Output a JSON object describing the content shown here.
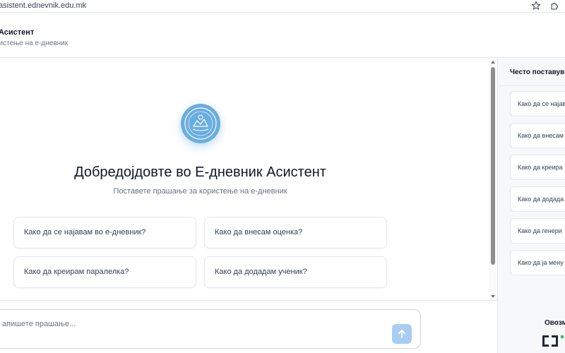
{
  "browser": {
    "url": "asistent.ednevnik.edu.mk",
    "icons": [
      "star-icon",
      "extensions-icon"
    ]
  },
  "header": {
    "title": "Асистент",
    "subtitle": "ристење на е-дневник"
  },
  "welcome": {
    "logo_icon": "emblem-logo",
    "title": "Добредојдовте во Е-дневник Асистент",
    "subtitle": "Поставете прашање за користење на е-дневник"
  },
  "suggestions": [
    {
      "label": "Како да се најавам во е-дневник?"
    },
    {
      "label": "Како да внесам оценка?"
    },
    {
      "label": "Како да креирам паралелка?"
    },
    {
      "label": "Како да додадам ученик?"
    }
  ],
  "composer": {
    "placeholder": "апишете прашање...",
    "send_icon": "arrow-up-icon"
  },
  "sidebar": {
    "title": "Често поставув",
    "faqs": [
      {
        "label": "Како да се најав"
      },
      {
        "label": "Како да внесам"
      },
      {
        "label": "Како да креира"
      },
      {
        "label": "Како да додада"
      },
      {
        "label": "Како да генери"
      },
      {
        "label": "Како да ја мену"
      }
    ],
    "footer_label": "Овозм"
  },
  "colors": {
    "accent": "#6aaee0",
    "send_button": "#a9cdf2",
    "sidebar_bg": "#f7f8fa",
    "border": "#e5e7eb"
  }
}
